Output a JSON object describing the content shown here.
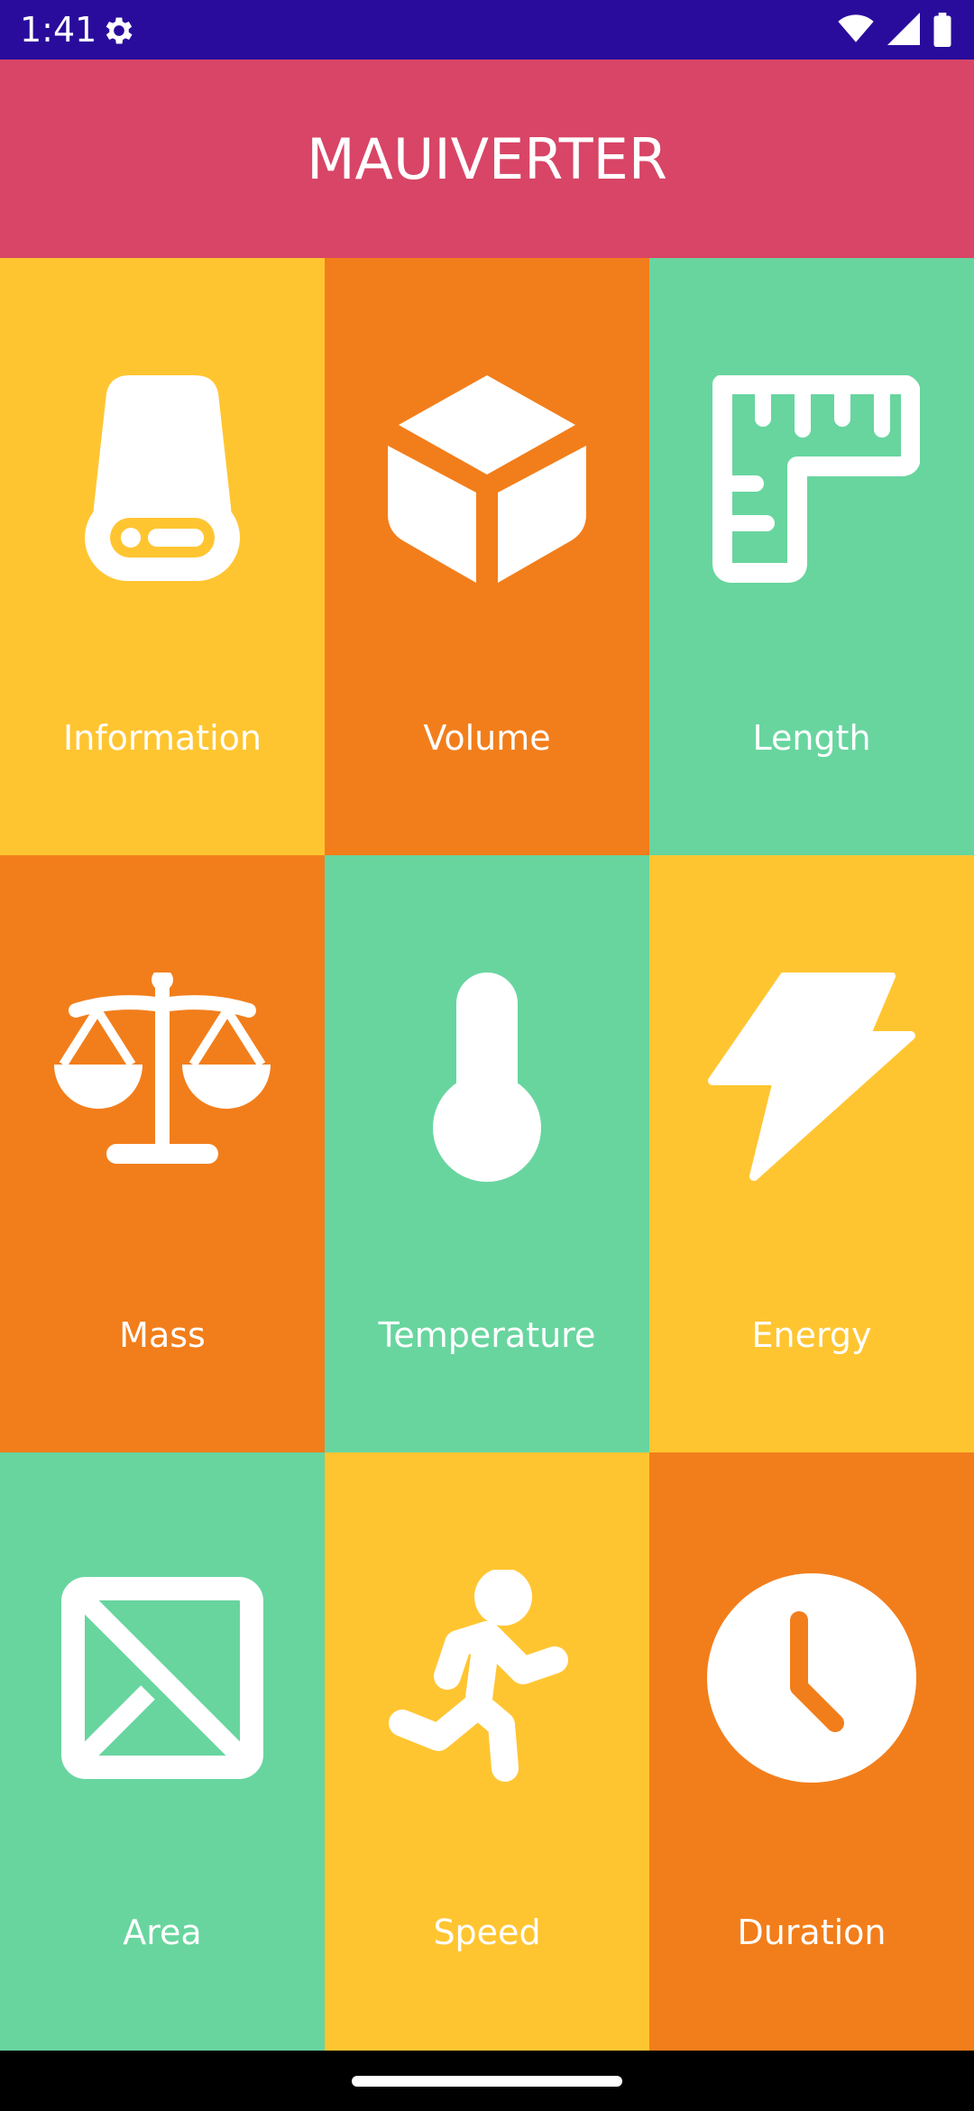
{
  "status_bar": {
    "time": "1:41",
    "icons": [
      "gear-icon",
      "wifi-icon",
      "signal-icon",
      "battery-icon"
    ]
  },
  "header": {
    "title": "MAUIVERTER",
    "color": "#D84566"
  },
  "tiles": [
    {
      "label": "Information",
      "icon": "hard-drive-icon",
      "color": "#FFC531"
    },
    {
      "label": "Volume",
      "icon": "cube-icon",
      "color": "#F27E1B"
    },
    {
      "label": "Length",
      "icon": "ruler-icon",
      "color": "#68D59F"
    },
    {
      "label": "Mass",
      "icon": "scale-icon",
      "color": "#F27E1B"
    },
    {
      "label": "Temperature",
      "icon": "thermometer-icon",
      "color": "#68D59F"
    },
    {
      "label": "Energy",
      "icon": "lightning-icon",
      "color": "#FFC531"
    },
    {
      "label": "Area",
      "icon": "area-icon",
      "color": "#68D59F"
    },
    {
      "label": "Speed",
      "icon": "running-icon",
      "color": "#FFC531"
    },
    {
      "label": "Duration",
      "icon": "clock-icon",
      "color": "#F27E1B"
    }
  ],
  "colors": {
    "status_bar": "#2A0C9C",
    "yellow": "#FFC531",
    "orange": "#F27E1B",
    "green": "#68D59F"
  }
}
